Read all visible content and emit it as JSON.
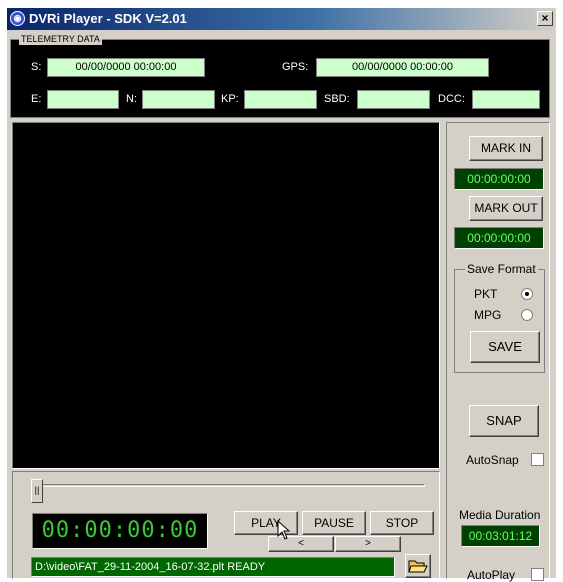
{
  "window": {
    "title": "DVRi Player - SDK V=2.01",
    "close_glyph": "×"
  },
  "telemetry": {
    "legend": "TELEMETRY DATA",
    "s_label": "S:",
    "s_value": "00/00/0000 00:00:00",
    "gps_label": "GPS:",
    "gps_value": "00/00/0000 00:00:00",
    "e_label": "E:",
    "e_value": "",
    "n_label": "N:",
    "n_value": "",
    "kp_label": "KP:",
    "kp_value": "",
    "sbd_label": "SBD:",
    "sbd_value": "",
    "dcc_label": "DCC:",
    "dcc_value": ""
  },
  "mark": {
    "in_label": "MARK IN",
    "in_time": "00:00:00:00",
    "out_label": "MARK OUT",
    "out_time": "00:00:00:00"
  },
  "save_format": {
    "legend": "Save Format",
    "pkt_label": "PKT",
    "pkt_checked": true,
    "mpg_label": "MPG",
    "mpg_checked": false,
    "save_label": "SAVE"
  },
  "snap": {
    "label": "SNAP",
    "autosnap_label": "AutoSnap",
    "autosnap_checked": false
  },
  "media": {
    "duration_label": "Media Duration",
    "duration_value": "00:03:01:12"
  },
  "autoplay": {
    "label": "AutoPlay",
    "checked": false
  },
  "transport": {
    "slider_thumb": "||",
    "timecode": "00:00:00:00",
    "play_label": "PLAY",
    "pause_label": "PAUSE",
    "stop_label": "STOP",
    "prev_label": "<",
    "next_label": ">"
  },
  "status": {
    "text": "D:\\video\\FAT_29-11-2004_16-07-32.plt  READY"
  },
  "icons": {
    "app": "dvri-logo-icon",
    "folder": "open-folder-icon",
    "cursor": "mouse-pointer-icon"
  },
  "colors": {
    "title_bar": "#0a246a",
    "field_bg": "#ccffcc",
    "timecode_text": "#66ff66",
    "status_bg": "#006600",
    "lcd_text": "#33cc33"
  }
}
